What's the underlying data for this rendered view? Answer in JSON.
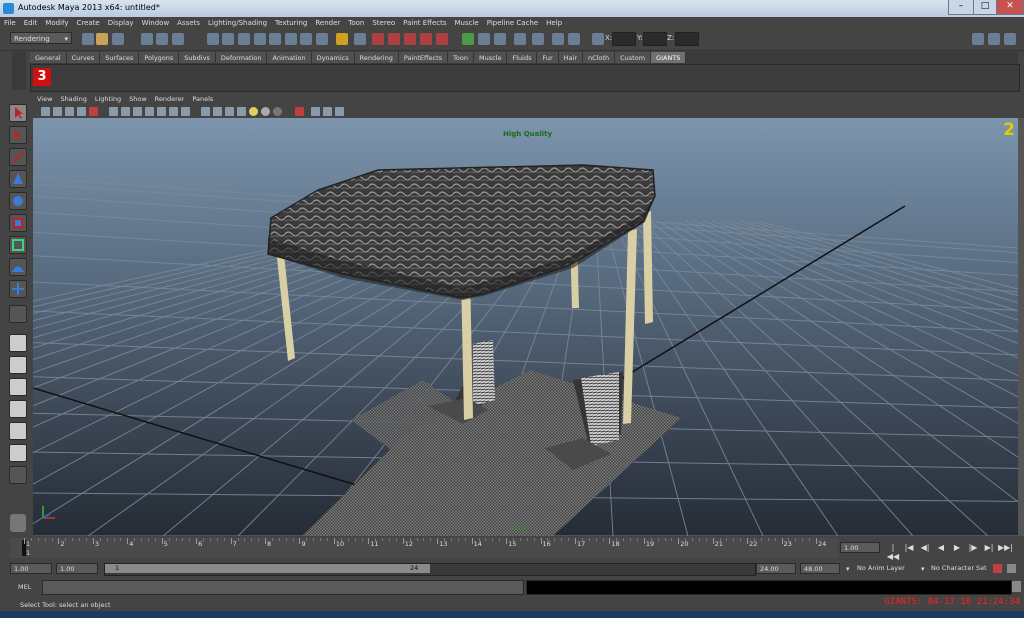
{
  "window": {
    "title": "Autodesk Maya 2013 x64: untitled*"
  },
  "menubar": [
    "File",
    "Edit",
    "Modify",
    "Create",
    "Display",
    "Window",
    "Assets",
    "Lighting/Shading",
    "Texturing",
    "Render",
    "Toon",
    "Stereo",
    "Paint Effects",
    "Muscle",
    "Pipeline Cache",
    "Help"
  ],
  "statusline": {
    "menuset": "Rendering",
    "coord_x": "X:",
    "coord_y": "Y:",
    "coord_z": "Z:"
  },
  "shelf": {
    "tabs": [
      "General",
      "Curves",
      "Surfaces",
      "Polygons",
      "Subdivs",
      "Deformation",
      "Animation",
      "Dynamics",
      "Rendering",
      "PaintEffects",
      "Toon",
      "Muscle",
      "Fluids",
      "Fur",
      "Hair",
      "nCloth",
      "Custom",
      "GIANTS"
    ],
    "active_tab": "GIANTS",
    "icon_label": "3"
  },
  "panel": {
    "menus": [
      "View",
      "Shading",
      "Lighting",
      "Show",
      "Renderer",
      "Panels"
    ],
    "hud_quality": "High Quality",
    "camera_number": "2",
    "view_label": "persp"
  },
  "timeline": {
    "ticks": [
      "1",
      "2",
      "3",
      "4",
      "5",
      "6",
      "7",
      "8",
      "9",
      "10",
      "11",
      "12",
      "13",
      "14",
      "15",
      "16",
      "17",
      "18",
      "19",
      "20",
      "21",
      "22",
      "23",
      "24"
    ],
    "current_frame": "1.00",
    "playback_icons": [
      "skip-start-icon",
      "step-back-key-icon",
      "step-back-icon",
      "play-back-icon",
      "play-forward-icon",
      "step-forward-icon",
      "step-forward-key-icon",
      "skip-end-icon"
    ]
  },
  "range": {
    "start_time": "1.00",
    "playback_start": "1.00",
    "range_start": "1",
    "range_end": "24",
    "playback_end": "24.00",
    "end_time": "48.00",
    "anim_layer": "No Anim Layer",
    "character_set": "No Character Set"
  },
  "commandline": {
    "label": "MEL"
  },
  "helpline": {
    "text": "Select Tool: select an object",
    "stamp": "GIANTS: 04-17-16 21:24:34"
  }
}
